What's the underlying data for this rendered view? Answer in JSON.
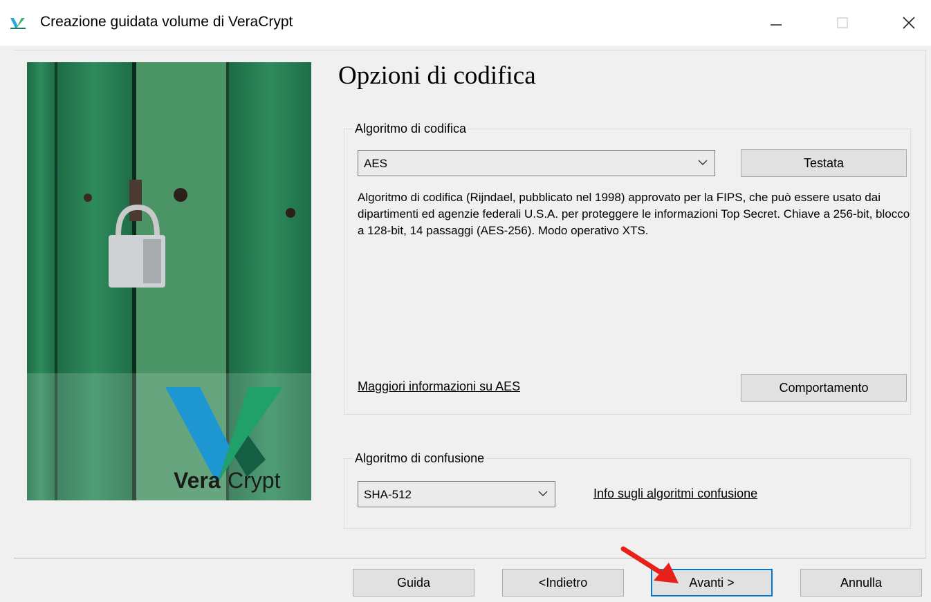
{
  "window": {
    "title": "Creazione guidata volume di VeraCrypt",
    "icon": "veracrypt-vc-icon",
    "minimize_glyph": "—",
    "close_glyph": "✕"
  },
  "page": {
    "heading": "Opzioni di codifica"
  },
  "side_image": {
    "logo_bold": "Vera",
    "logo_light": "Crypt"
  },
  "encryption": {
    "group_label": "Algoritmo di codifica",
    "selected": "AES",
    "test_button": "Testata",
    "description": "Algoritmo di codifica (Rijndael, pubblicato nel 1998) approvato per la FIPS, che può essere usato dai dipartimenti ed agenzie federali U.S.A. per proteggere le informazioni Top Secret. Chiave a 256-bit, blocco a 128-bit, 14 passaggi (AES-256). Modo operativo XTS.",
    "more_info_link": "Maggiori informazioni su AES",
    "behavior_button": "Comportamento"
  },
  "hash": {
    "group_label": "Algoritmo di confusione",
    "selected": "SHA-512",
    "info_link": "Info sugli algoritmi confusione"
  },
  "footer": {
    "help": "Guida",
    "back": "<Indietro",
    "next": "Avanti >",
    "cancel": "Annulla"
  },
  "colors": {
    "accent": "#0078d7",
    "annotation_arrow": "#e8201a",
    "window_bg": "#f0f0f0"
  }
}
